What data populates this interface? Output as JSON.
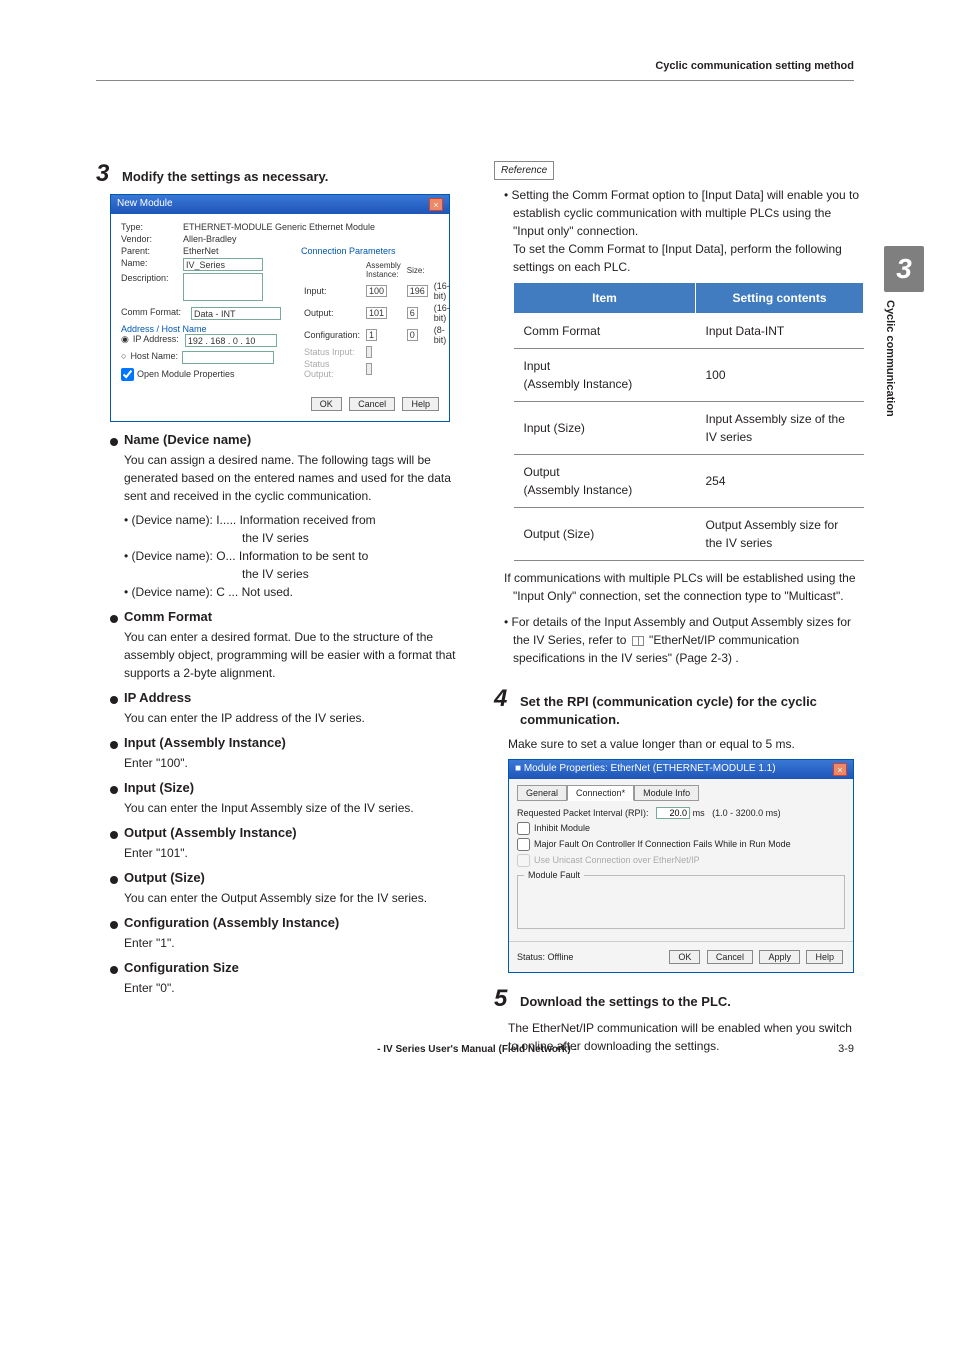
{
  "header": {
    "breadcrumb": "Cyclic communication setting method"
  },
  "side_tab": {
    "num": "3",
    "label": "Cyclic communication"
  },
  "left": {
    "step3": {
      "num": "3",
      "text": "Modify the settings as necessary."
    },
    "dialog1": {
      "title": "New Module",
      "rows": {
        "type_lbl": "Type:",
        "type_val": "ETHERNET-MODULE Generic Ethernet Module",
        "vendor_lbl": "Vendor:",
        "vendor_val": "Allen-Bradley",
        "parent_lbl": "Parent:",
        "parent_val": "EtherNet",
        "name_lbl": "Name:",
        "name_val": "IV_Series",
        "desc_lbl": "Description:",
        "comm_lbl": "Comm Format:",
        "comm_val": "Data - INT",
        "addr_lbl": "Address / Host Name",
        "ip_lbl": "IP Address:",
        "ip_val": "192 . 168 .   0 .  10",
        "host_lbl": "Host Name:"
      },
      "conn": {
        "hdr": "Connection Parameters",
        "col1": "Assembly\nInstance:",
        "col2": "Size:",
        "input_lbl": "Input:",
        "input_inst": "100",
        "input_size": "196",
        "unit1": "(16-bit)",
        "output_lbl": "Output:",
        "output_inst": "101",
        "output_size": "6",
        "unit2": "(16-bit)",
        "config_lbl": "Configuration:",
        "config_inst": "1",
        "config_size": "0",
        "unit3": "(8-bit)",
        "status_in": "Status Input:",
        "status_out": "Status Output:"
      },
      "open_mod": "Open Module Properties",
      "btn_ok": "OK",
      "btn_cancel": "Cancel",
      "btn_help": "Help"
    },
    "sec_name": {
      "h": "Name (Device name)",
      "p": "You can assign a desired name. The following tags will be generated based on the entered names and used for the data sent and received in the cyclic communication.",
      "b1a": "• (Device name): I..... Information received from",
      "b1b": "the IV series",
      "b2a": "• (Device name): O... Information to be sent to",
      "b2b": "the IV series",
      "b3": "• (Device name): C ... Not used."
    },
    "sec_comm": {
      "h": "Comm Format",
      "p": "You can enter a desired format. Due to the structure of the assembly object, programming will be easier with a format that supports a 2-byte alignment."
    },
    "sec_ip": {
      "h": "IP Address",
      "p": "You can enter the IP address of the IV series."
    },
    "sec_in_inst": {
      "h": "Input (Assembly Instance)",
      "p": "Enter \"100\"."
    },
    "sec_in_size": {
      "h": "Input (Size)",
      "p": "You can enter the Input Assembly size of the IV series."
    },
    "sec_out_inst": {
      "h": "Output (Assembly Instance)",
      "p": "Enter \"101\"."
    },
    "sec_out_size": {
      "h": "Output (Size)",
      "p": "You can enter the Output Assembly size for the IV series."
    },
    "sec_cfg_inst": {
      "h": "Configuration (Assembly Instance)",
      "p": "Enter \"1\"."
    },
    "sec_cfg_size": {
      "h": "Configuration Size",
      "p": "Enter \"0\"."
    }
  },
  "right": {
    "ref_label": "Reference",
    "ref1": "Setting the Comm Format option to [Input Data] will enable you to establish cyclic communication with multiple PLCs using the \"Input only\" connection.",
    "ref1b": "To set the Comm Format to [Input Data], perform the following settings on each PLC.",
    "table": {
      "h1": "Item",
      "h2": "Setting contents",
      "r1c1": "Comm Format",
      "r1c2": "Input Data-INT",
      "r2c1": "Input\n(Assembly Instance)",
      "r2c2": "100",
      "r3c1": "Input (Size)",
      "r3c2": "Input Assembly size of the IV series",
      "r4c1": "Output\n(Assembly Instance)",
      "r4c2": "254",
      "r5c1": "Output (Size)",
      "r5c2": "Output Assembly size for the IV series"
    },
    "ref_after": "If communications with multiple PLCs will be established using the \"Input Only\" connection, set the connection type to \"Multicast\".",
    "ref2a": "For details of the Input Assembly and Output Assembly sizes for the IV Series, refer to ",
    "ref2b": " \"EtherNet/IP communication specifications in the IV series\" (Page 2-3) .",
    "step4": {
      "num": "4",
      "text": "Set the RPI (communication cycle) for the cyclic communication.",
      "sub": "Make sure to set a value longer than or equal to 5 ms."
    },
    "dialog2": {
      "title": "Module Properties: EtherNet (ETHERNET-MODULE 1.1)",
      "tab1": "General",
      "tab2": "Connection*",
      "tab3": "Module Info",
      "rpi_lbl": "Requested Packet Interval (RPI):",
      "rpi_val": "20.0",
      "rpi_unit": "ms",
      "rpi_range": "(1.0 - 3200.0 ms)",
      "inhibit": "Inhibit Module",
      "major_fault": "Major Fault On Controller If Connection Fails While in Run Mode",
      "unicast": "Use Unicast Connection over EtherNet/IP",
      "module_fault": "Module Fault",
      "status_lbl": "Status:",
      "status_val": "Offline",
      "btn_ok": "OK",
      "btn_cancel": "Cancel",
      "btn_apply": "Apply",
      "btn_help": "Help"
    },
    "step5": {
      "num": "5",
      "text": "Download the settings to the PLC.",
      "sub": "The EtherNet/IP communication will be enabled when you switch to online after downloading the settings."
    }
  },
  "footer": {
    "title": "- IV Series User's Manual (Field Network) -",
    "page": "3-9"
  }
}
